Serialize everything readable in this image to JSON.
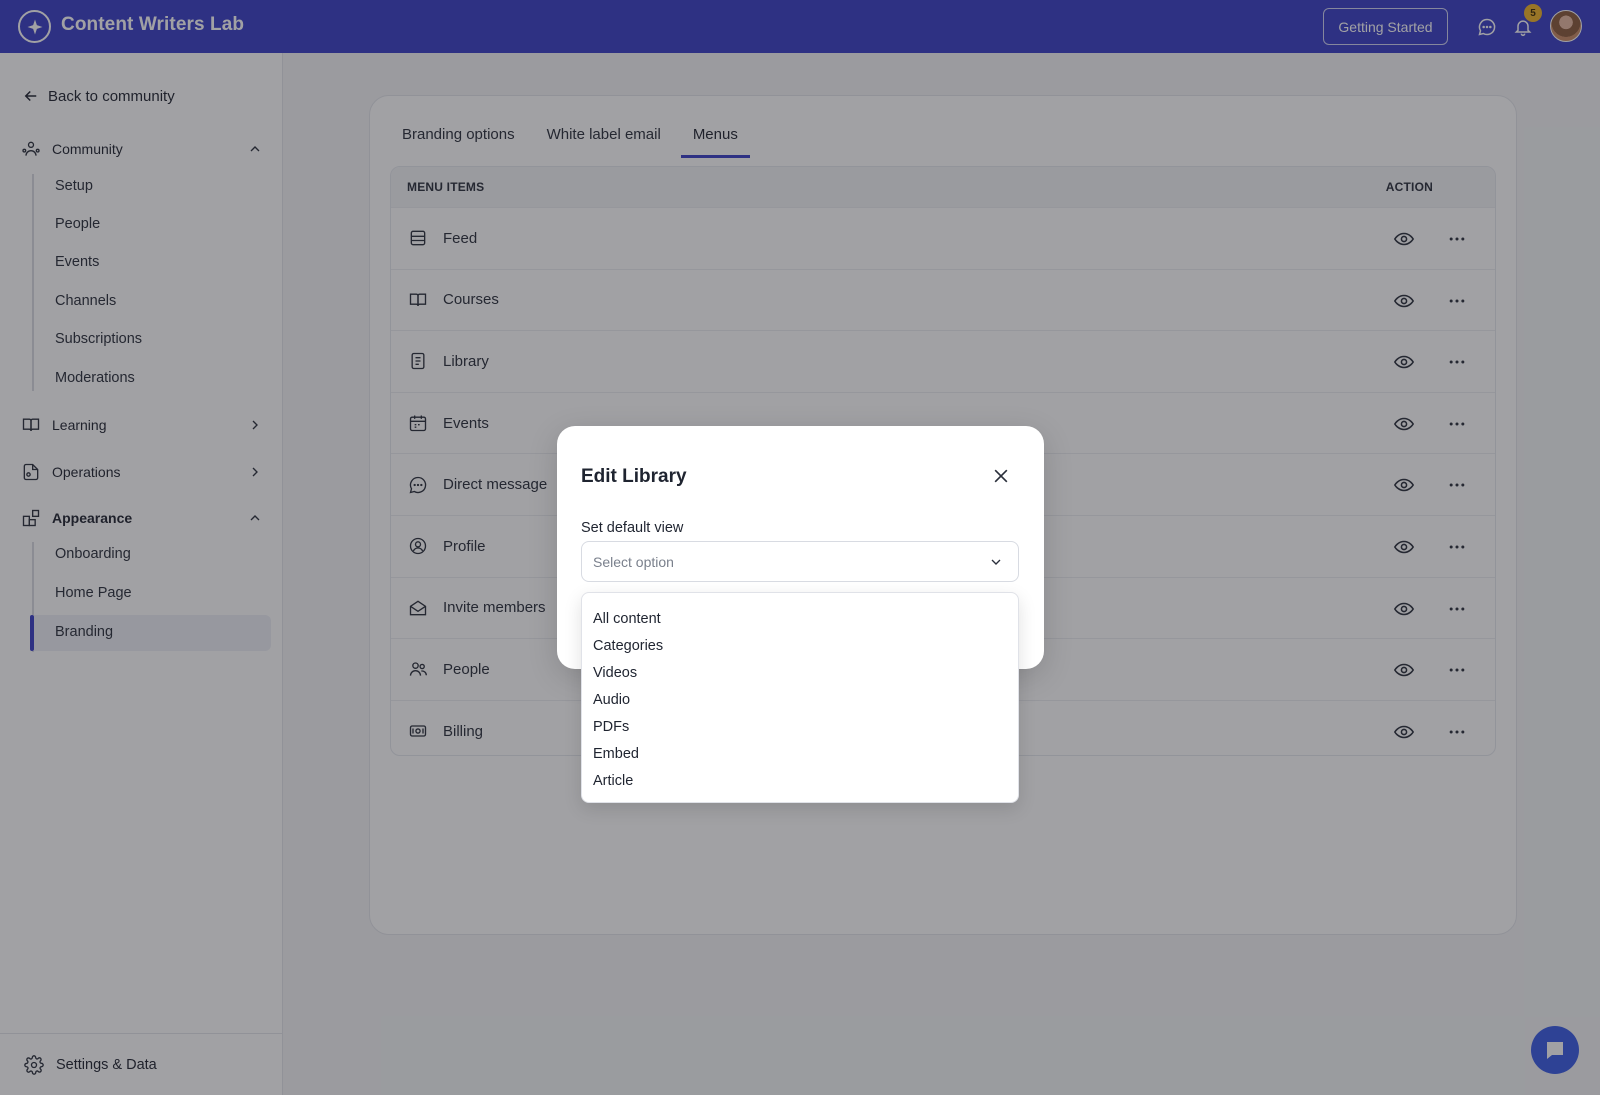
{
  "app": {
    "title": "Content Writers Lab",
    "getting_started": "Getting Started",
    "notification_count": "5"
  },
  "sidebar": {
    "back": "Back to community",
    "community": {
      "label": "Community",
      "items": [
        "Setup",
        "People",
        "Events",
        "Channels",
        "Subscriptions",
        "Moderations"
      ]
    },
    "learning": {
      "label": "Learning"
    },
    "operations": {
      "label": "Operations"
    },
    "appearance": {
      "label": "Appearance",
      "items": [
        "Onboarding",
        "Home Page",
        "Branding"
      ],
      "active": "Branding"
    },
    "footer": "Settings & Data"
  },
  "tabs": [
    "Branding options",
    "White label email",
    "Menus"
  ],
  "active_tab": "Menus",
  "table": {
    "headers": {
      "items": "MENU ITEMS",
      "action": "ACTION"
    },
    "rows": [
      {
        "label": "Feed",
        "icon": "feed-icon"
      },
      {
        "label": "Courses",
        "icon": "book-icon"
      },
      {
        "label": "Library",
        "icon": "document-icon"
      },
      {
        "label": "Events",
        "icon": "calendar-icon"
      },
      {
        "label": "Direct message",
        "icon": "chat-bubble-icon"
      },
      {
        "label": "Profile",
        "icon": "user-circle-icon"
      },
      {
        "label": "Invite members",
        "icon": "envelope-icon"
      },
      {
        "label": "People",
        "icon": "users-icon"
      },
      {
        "label": "Billing",
        "icon": "billing-icon"
      }
    ]
  },
  "modal": {
    "title": "Edit Library",
    "field_label": "Set default view",
    "placeholder": "Select option",
    "options": [
      "All content",
      "Categories",
      "Videos",
      "Audio",
      "PDFs",
      "Embed",
      "Article"
    ]
  },
  "colors": {
    "brand": "#3a3fc7",
    "badge": "#f0b429",
    "chat_fab": "#3a5ce6"
  }
}
